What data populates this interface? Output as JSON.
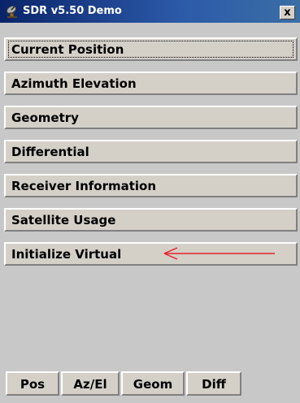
{
  "window": {
    "title": "SDR v5.50 Demo",
    "close_label": "x"
  },
  "menu": {
    "items": [
      {
        "label": "Current Position"
      },
      {
        "label": "Azimuth Elevation"
      },
      {
        "label": "Geometry"
      },
      {
        "label": "Differential"
      },
      {
        "label": "Receiver Information"
      },
      {
        "label": "Satellite Usage"
      },
      {
        "label": "Initialize Virtual"
      }
    ]
  },
  "tabs": [
    {
      "label": "Pos"
    },
    {
      "label": "Az/El"
    },
    {
      "label": "Geom"
    },
    {
      "label": "Diff"
    }
  ],
  "icons": {
    "app": "satellite-dish-icon",
    "close": "close-icon",
    "annotation": "red-arrow-icon"
  },
  "colors": {
    "titlebar": "#0a246a",
    "face": "#d4d0c8",
    "background": "#c8c8c8",
    "arrow": "#e8202a"
  }
}
